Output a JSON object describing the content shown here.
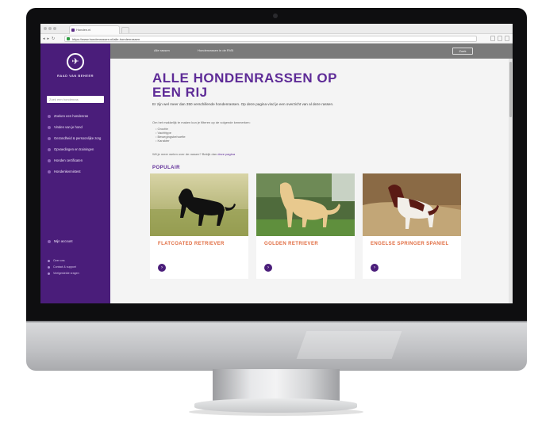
{
  "browser": {
    "tab_title": "Honden.nl",
    "user": "",
    "url": "https://www.hondenrassen.nl/alle-hondenrassen"
  },
  "site": {
    "logo_text": "RAAD VAN BEHEER",
    "search_placeholder": "Zoek een hondenras",
    "nav": [
      {
        "label": "Zoeken een hondenras"
      },
      {
        "label": "Vinden van je hond"
      },
      {
        "label": "Gezondheid & persoonlijke zorg"
      },
      {
        "label": "Opvoedingen en trainingen"
      },
      {
        "label": "Honden certificaten"
      },
      {
        "label": "Hondenkennistest"
      }
    ],
    "my_account": "Mijn account",
    "bottom_links": [
      "Over ons",
      "Contact & support",
      "Veelgestelde vragen"
    ],
    "topbar": {
      "crumb1": "Alle rassen",
      "crumb2": "Hondenrassen in de RVB",
      "button": "Zoek"
    },
    "title": "ALLE HONDENRASSEN OP EEN RIJ",
    "intro": "Er zijn wel meer dan 350 verschillende hondenrassen. Op deze pagina vind je een overzicht van al deze rassen.",
    "intro2": "Om het makkelijk te maken kun je filteren op de volgende kenmerken:",
    "bullets": [
      "Grootte",
      "Vachttype",
      "Bewegingsbehoefte",
      "Karakter"
    ],
    "more_prefix": "Wil je meer weten over de rassen? Bekijk dan",
    "more_link": "deze pagina",
    "section": "POPULAIR",
    "cards": [
      {
        "name": "FLATCOATED RETRIEVER",
        "btn": "›"
      },
      {
        "name": "GOLDEN RETRIEVER",
        "btn": "›"
      },
      {
        "name": "ENGELSE SPRINGER SPANIEL",
        "btn": "›"
      }
    ]
  },
  "colors": {
    "brand_purple": "#4a1d7a",
    "title_purple": "#5e2b97",
    "card_title_orange": "#e06a3e"
  }
}
